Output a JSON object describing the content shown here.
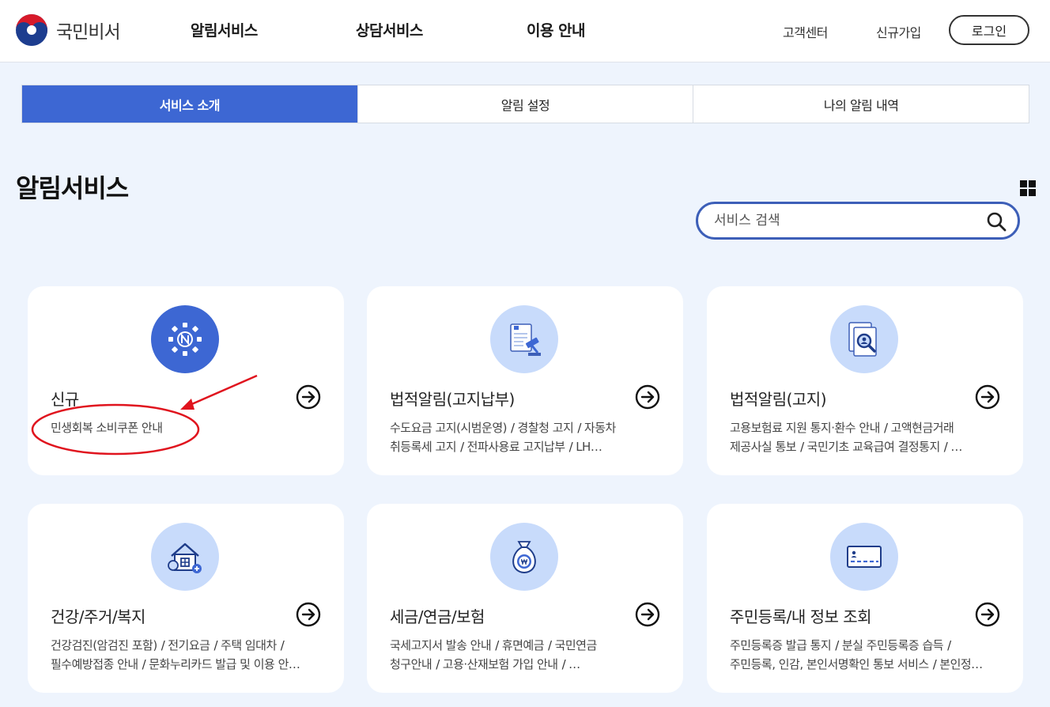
{
  "header": {
    "logo_text": "국민비서",
    "nav": [
      "알림서비스",
      "상담서비스",
      "이용 안내"
    ],
    "customer_center": "고객센터",
    "signup": "신규가입",
    "login": "로그인"
  },
  "tabs": [
    {
      "label": "서비스 소개",
      "active": true
    },
    {
      "label": "알림 설정",
      "active": false
    },
    {
      "label": "나의 알림 내역",
      "active": false
    }
  ],
  "page_title": "알림서비스",
  "search": {
    "placeholder": "서비스 검색",
    "value": ""
  },
  "cards": [
    {
      "title": "신규",
      "icon": "new-badge-icon",
      "items": [
        "민생회복 소비쿠폰 안내"
      ]
    },
    {
      "title": "법적알림(고지납부)",
      "icon": "gavel-document-icon",
      "line1": [
        "수도요금 고지(시범운영)",
        "경찰청 고지",
        "자동차"
      ],
      "line2": [
        "취등록세 고지",
        "전파사용료 고지납부",
        "LH…"
      ]
    },
    {
      "title": "법적알림(고지)",
      "icon": "document-search-icon",
      "line1": [
        "고용보험료 지원 통지·환수 안내",
        "고액현금거래"
      ],
      "line2": [
        "제공사실 통보",
        "국민기초 교육급여 결정통지",
        "…"
      ]
    },
    {
      "title": "건강/주거/복지",
      "icon": "house-icon",
      "line1": [
        "건강검진(암검진 포함)",
        "전기요금",
        "주택 임대차",
        ""
      ],
      "line2": [
        "필수예방접종 안내",
        "문화누리카드 발급 및 이용 안…"
      ]
    },
    {
      "title": "세금/연금/보험",
      "icon": "money-bag-icon",
      "line1": [
        "국세고지서 발송 안내",
        "휴면예금",
        "국민연금"
      ],
      "line2": [
        "청구안내",
        "고용·산재보험 가입 안내",
        "…"
      ]
    },
    {
      "title": "주민등록/내 정보 조회",
      "icon": "id-card-icon",
      "line1": [
        "주민등록증 발급 통지",
        "분실 주민등록증 습득",
        ""
      ],
      "line2": [
        "주민등록, 인감, 본인서명확인 통보 서비스",
        "본인정…"
      ]
    }
  ],
  "colors": {
    "primary": "#3d67d3",
    "icon_bg": "#c8dbfb",
    "page_bg": "#eef4fd",
    "annotation": "#e0141e"
  }
}
